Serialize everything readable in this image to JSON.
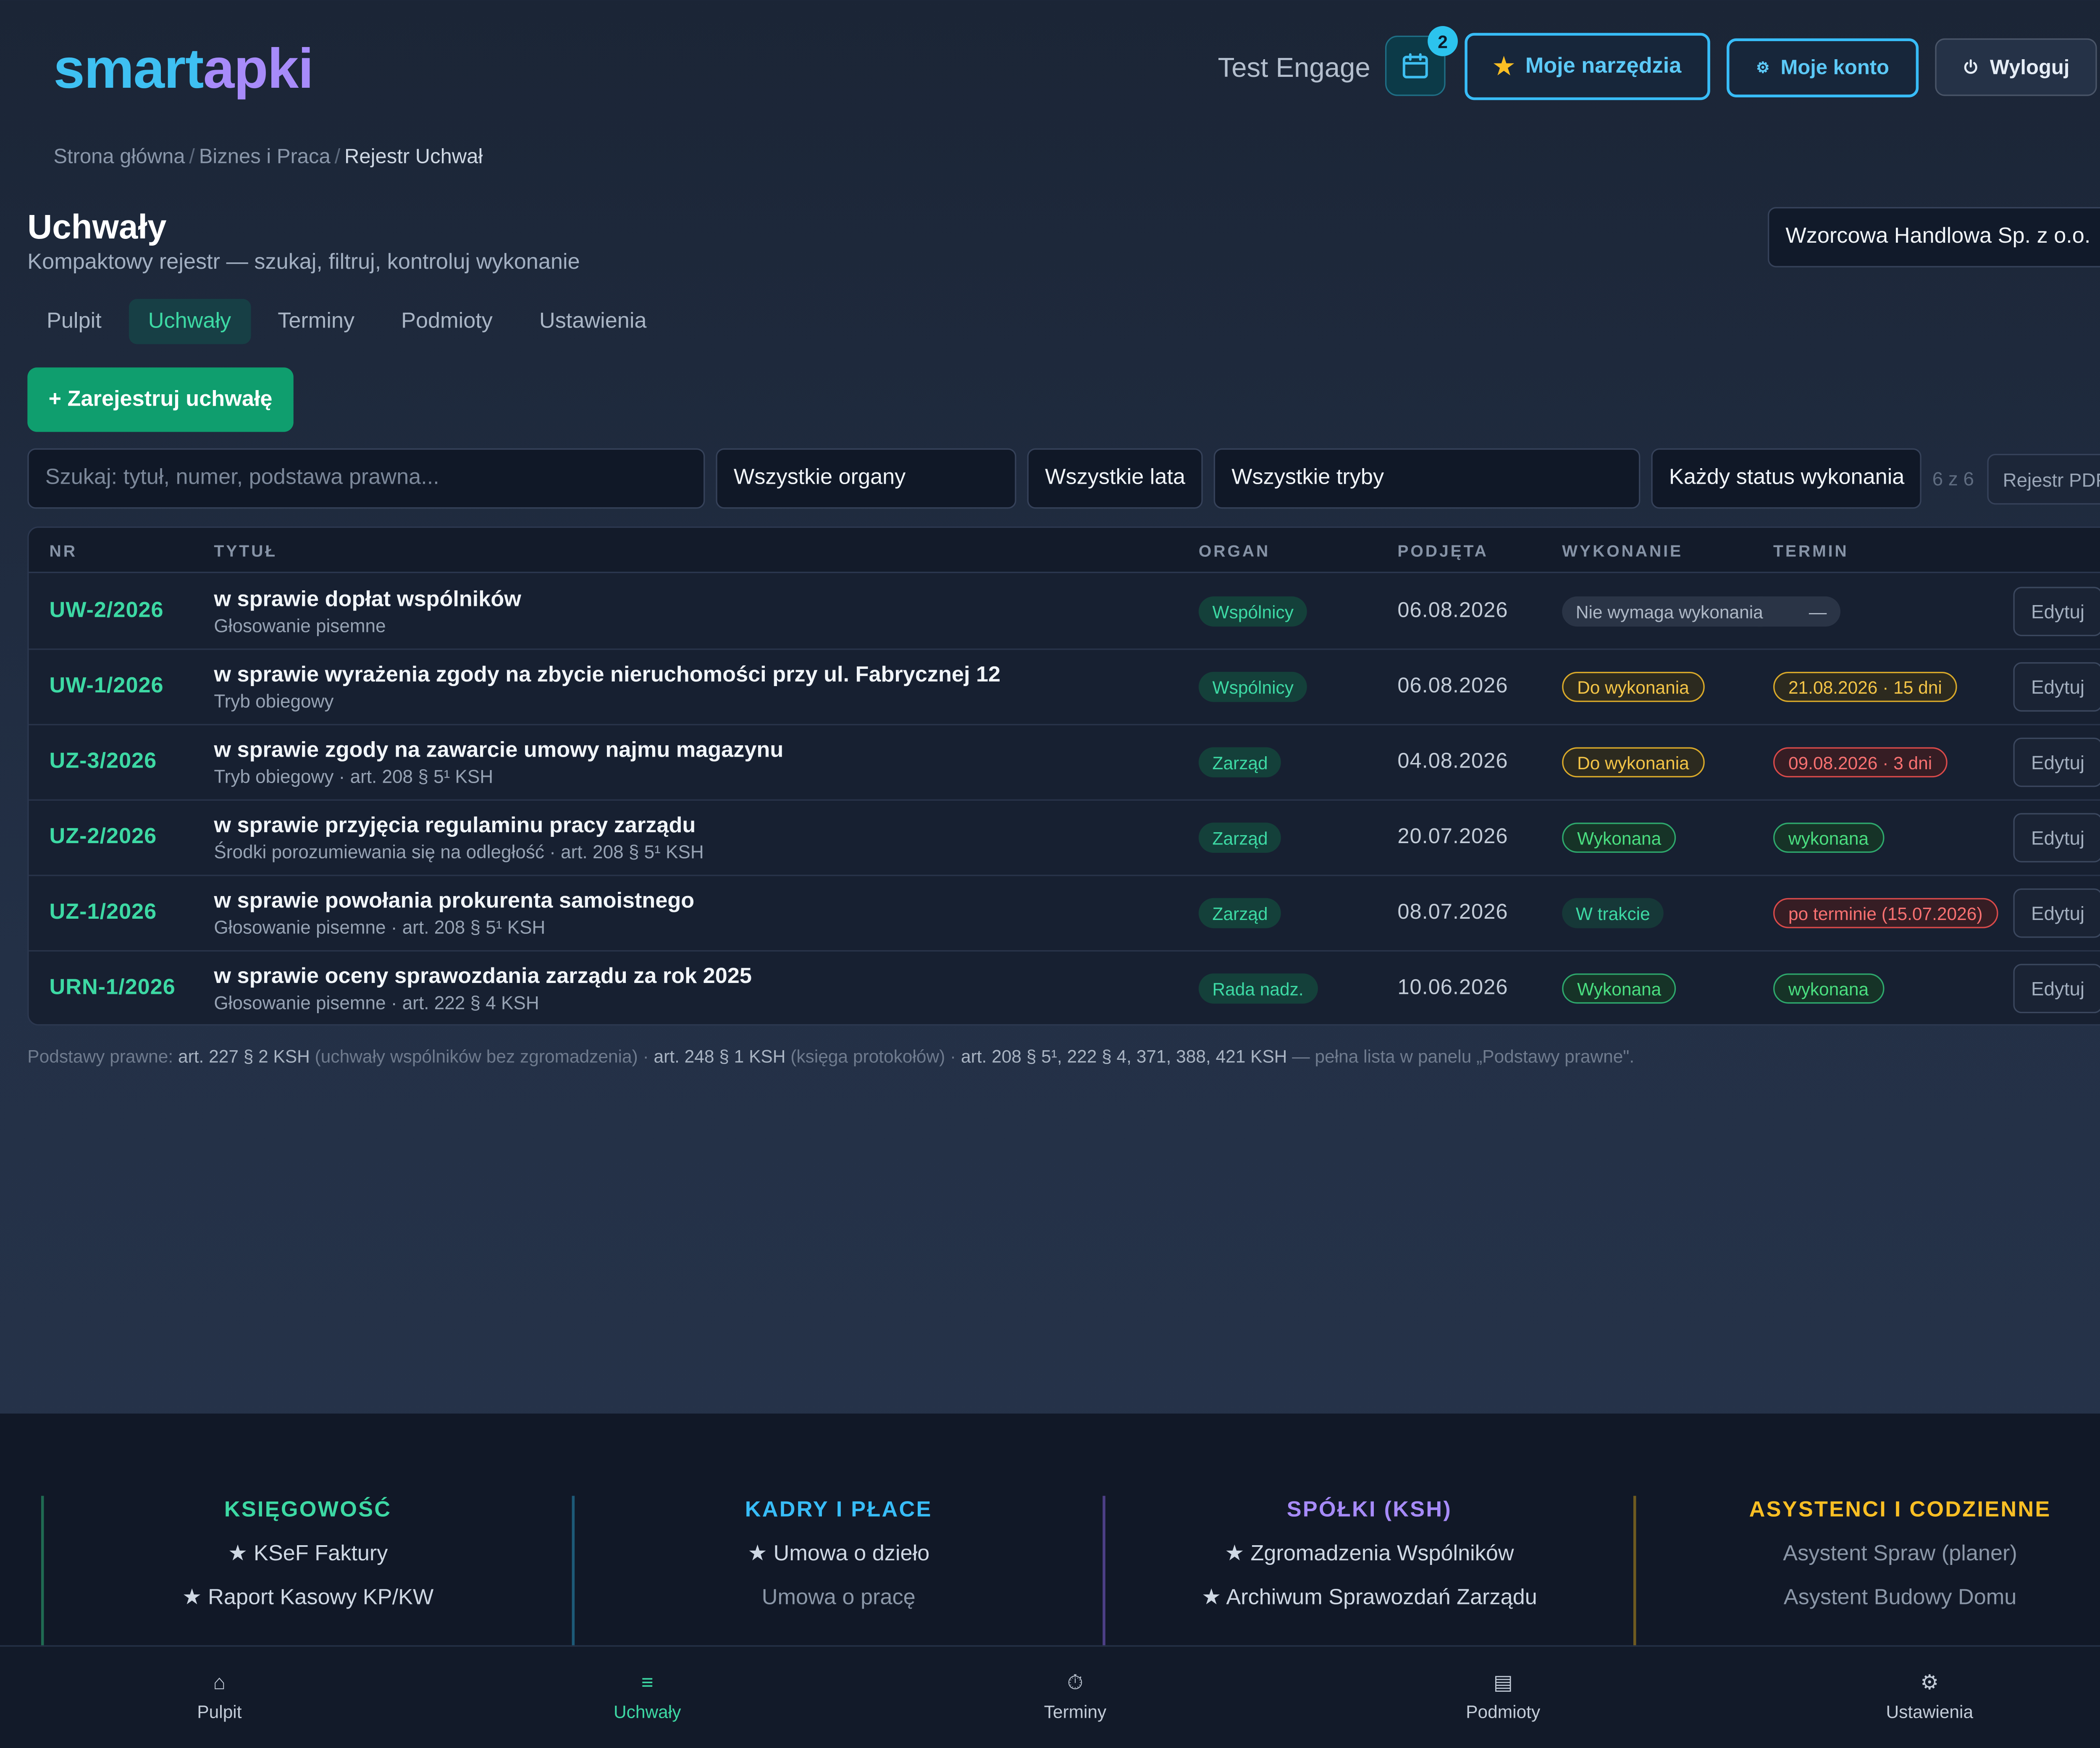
{
  "header": {
    "logo_part1": "smart",
    "logo_part2": "apki",
    "user_name": "Test Engage",
    "calendar_badge": "2",
    "my_tools_label": "Moje narzędzia",
    "my_account_label": "Moje konto",
    "logout_label": "Wyloguj"
  },
  "breadcrumb": {
    "items": [
      "Strona główna",
      "Biznes i Praca",
      "Rejestr Uchwał"
    ],
    "separator": "/"
  },
  "page": {
    "title": "Uchwały",
    "subtitle": "Kompaktowy rejestr — szukaj, filtruj, kontroluj wykonanie",
    "company": "Wzorcowa Handlowa Sp. z o.o."
  },
  "tabs": [
    {
      "label": "Pulpit",
      "active": false
    },
    {
      "label": "Uchwały",
      "active": true
    },
    {
      "label": "Terminy",
      "active": false
    },
    {
      "label": "Podmioty",
      "active": false
    },
    {
      "label": "Ustawienia",
      "active": false
    }
  ],
  "actions": {
    "register_label": "+ Zarejestruj uchwałę"
  },
  "filters": {
    "search_placeholder": "Szukaj: tytuł, numer, podstawa prawna...",
    "organ": "Wszystkie organy",
    "year": "Wszystkie lata",
    "mode": "Wszystkie tryby",
    "status": "Każdy status wykonania",
    "count": "6 z 6",
    "pdf_label": "Rejestr PDF"
  },
  "table": {
    "columns": [
      "NR",
      "TYTUŁ",
      "ORGAN",
      "PODJĘTA",
      "WYKONANIE",
      "TERMIN"
    ],
    "rows": [
      {
        "nr": "UW-2/2026",
        "title": "w sprawie dopłat wspólników",
        "sub": "Głosowanie pisemne",
        "organ": "Wspólnicy",
        "date": "06.08.2026",
        "exec": "Nie wymaga wykonania",
        "exec_style": "none",
        "term": "—",
        "term_style": "none",
        "edit": "Edytuj"
      },
      {
        "nr": "UW-1/2026",
        "title": "w sprawie wyrażenia zgody na zbycie nieruchomości przy ul. Fabrycznej 12",
        "sub": "Tryb obiegowy",
        "organ": "Wspólnicy",
        "date": "06.08.2026",
        "exec": "Do wykonania",
        "exec_style": "todo",
        "term": "21.08.2026 · 15 dni",
        "term_style": "warn",
        "edit": "Edytuj"
      },
      {
        "nr": "UZ-3/2026",
        "title": "w sprawie zgody na zawarcie umowy najmu magazynu",
        "sub": "Tryb obiegowy · art. 208 § 5¹ KSH",
        "organ": "Zarząd",
        "date": "04.08.2026",
        "exec": "Do wykonania",
        "exec_style": "todo",
        "term": "09.08.2026 · 3 dni",
        "term_style": "late",
        "edit": "Edytuj"
      },
      {
        "nr": "UZ-2/2026",
        "title": "w sprawie przyjęcia regulaminu pracy zarządu",
        "sub": "Środki porozumiewania się na odległość · art. 208 § 5¹ KSH",
        "organ": "Zarząd",
        "date": "20.07.2026",
        "exec": "Wykonana",
        "exec_style": "done",
        "term": "wykonana",
        "term_style": "done",
        "edit": "Edytuj"
      },
      {
        "nr": "UZ-1/2026",
        "title": "w sprawie powołania prokurenta samoistnego",
        "sub": "Głosowanie pisemne · art. 208 § 5¹ KSH",
        "organ": "Zarząd",
        "date": "08.07.2026",
        "exec": "W trakcie",
        "exec_style": "prog",
        "term": "po terminie (15.07.2026)",
        "term_style": "late",
        "edit": "Edytuj"
      },
      {
        "nr": "URN-1/2026",
        "title": "w sprawie oceny sprawozdania zarządu za rok 2025",
        "sub": "Głosowanie pisemne · art. 222 § 4 KSH",
        "organ": "Rada nadz.",
        "date": "10.06.2026",
        "exec": "Wykonana",
        "exec_style": "done",
        "term": "wykonana",
        "term_style": "done",
        "edit": "Edytuj"
      }
    ]
  },
  "footnote": {
    "p1": "Podstawy prawne: ",
    "p2": "art. 227 § 2 KSH",
    "p3": " (uchwały wspólników bez zgromadzenia) · ",
    "p4": "art. 248 § 1 KSH",
    "p5": " (księga protokołów) · ",
    "p6": "art. 208 § 5¹, 222 § 4, 371, 388, 421 KSH",
    "p7": " — pełna lista w panelu „Podstawy prawne\"."
  },
  "footer": {
    "columns": [
      {
        "title": "KSIĘGOWOŚĆ",
        "color": "#3dd9a4",
        "items": [
          "★ KSeF Faktury",
          "★ Raport Kasowy KP/KW"
        ]
      },
      {
        "title": "KADRY I PŁACE",
        "color": "#38bdf8",
        "items": [
          "★ Umowa o dzieło",
          "Umowa o pracę"
        ]
      },
      {
        "title": "SPÓŁKI (KSH)",
        "color": "#a78bfa",
        "items": [
          "★ Zgromadzenia Wspólników",
          "★ Archiwum Sprawozdań Zarządu"
        ]
      },
      {
        "title": "ASYSTENCI I CODZIENNE",
        "color": "#fbbf24",
        "items": [
          "Asystent Spraw (planer)",
          "Asystent Budowy Domu"
        ]
      }
    ]
  },
  "bottom_nav": [
    {
      "label": "Pulpit",
      "icon": "⌂",
      "active": false
    },
    {
      "label": "Uchwały",
      "icon": "≡",
      "active": true
    },
    {
      "label": "Terminy",
      "icon": "⏱",
      "active": false
    },
    {
      "label": "Podmioty",
      "icon": "▤",
      "active": false
    },
    {
      "label": "Ustawienia",
      "icon": "⚙",
      "active": false
    }
  ],
  "colors": {
    "accent_green": "#3dd9a4",
    "accent_blue": "#38bdf8",
    "primary_button": "#0f9e6e"
  }
}
